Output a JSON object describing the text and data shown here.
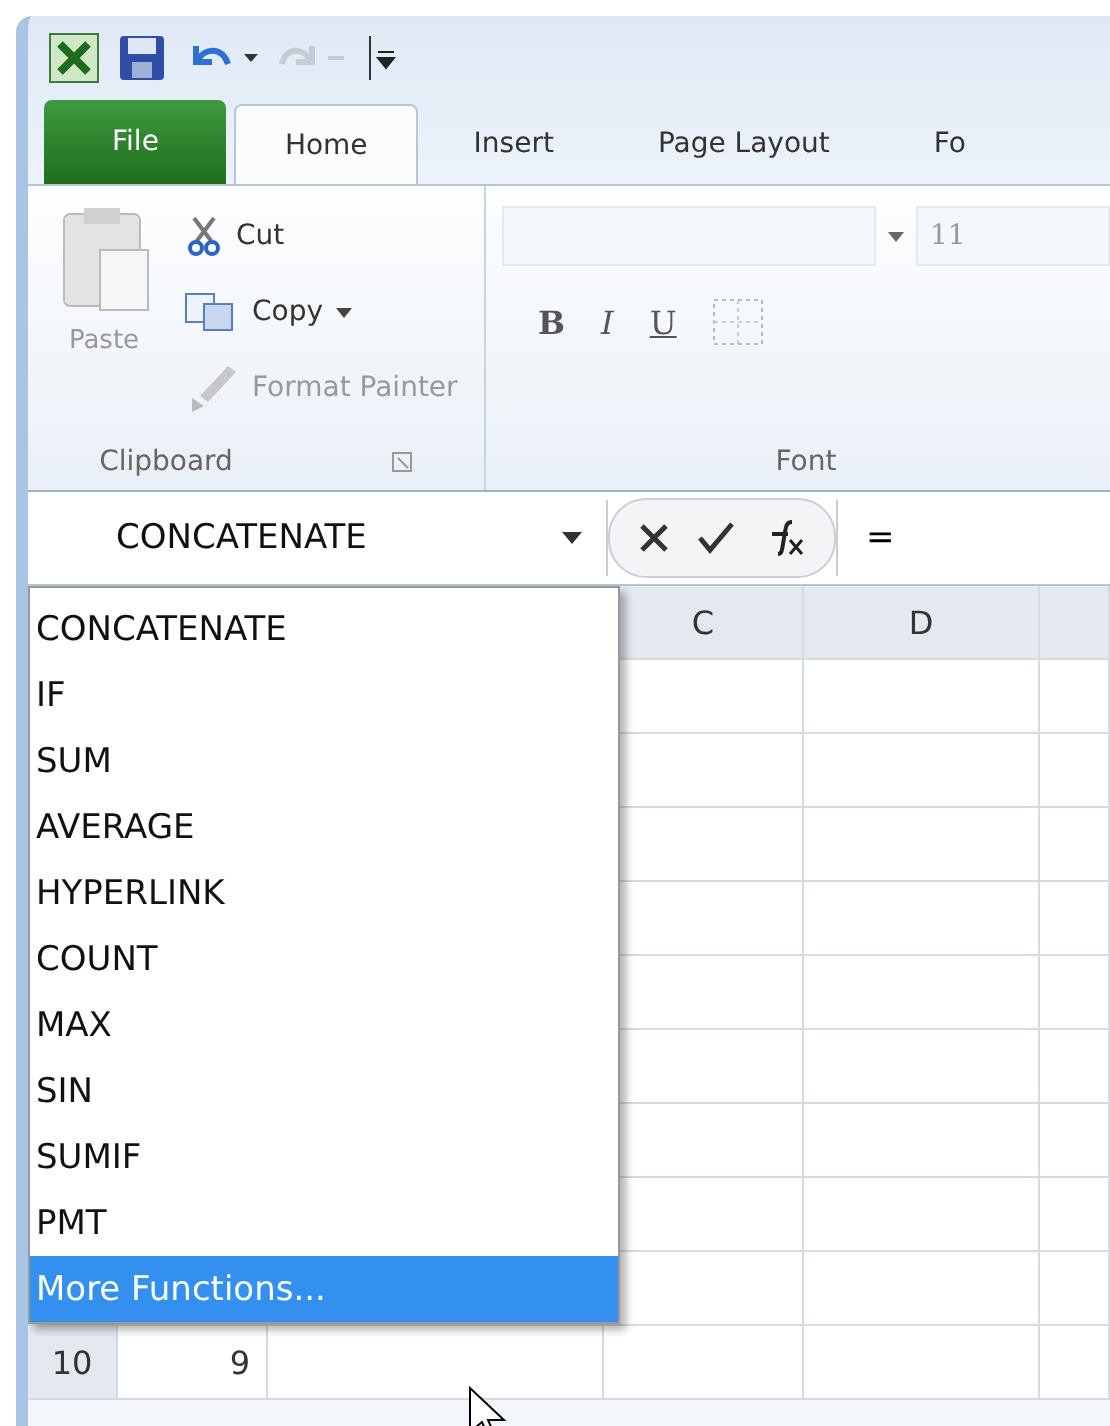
{
  "quick_access": {
    "redo_disabled": true
  },
  "tabs": [
    {
      "label": "File",
      "kind": "file",
      "selected": false
    },
    {
      "label": "Home",
      "kind": "tab",
      "selected": true
    },
    {
      "label": "Insert",
      "kind": "tab",
      "selected": false
    },
    {
      "label": "Page Layout",
      "kind": "tab",
      "selected": false
    },
    {
      "label": "Fo",
      "kind": "tab",
      "selected": false
    }
  ],
  "clipboard": {
    "title": "Clipboard",
    "paste": {
      "label": "Paste",
      "disabled": true
    },
    "cut": {
      "label": "Cut",
      "disabled": false
    },
    "copy": {
      "label": "Copy",
      "disabled": false
    },
    "format_painter": {
      "label": "Format Painter",
      "disabled": true
    }
  },
  "font": {
    "title": "Font",
    "size": "11",
    "bold": "B",
    "italic": "I",
    "underline": "U"
  },
  "formula_bar": {
    "name_box": "CONCATENATE",
    "formula": "="
  },
  "function_list": [
    {
      "label": "CONCATENATE",
      "selected": false
    },
    {
      "label": "IF",
      "selected": false
    },
    {
      "label": "SUM",
      "selected": false
    },
    {
      "label": "AVERAGE",
      "selected": false
    },
    {
      "label": "HYPERLINK",
      "selected": false
    },
    {
      "label": "COUNT",
      "selected": false
    },
    {
      "label": "MAX",
      "selected": false
    },
    {
      "label": "SIN",
      "selected": false
    },
    {
      "label": "SUMIF",
      "selected": false
    },
    {
      "label": "PMT",
      "selected": false
    },
    {
      "label": "More Functions...",
      "selected": true
    }
  ],
  "grid": {
    "visible_columns": [
      "C",
      "D"
    ],
    "rows": [
      {
        "header": "10",
        "cells": [
          "9"
        ]
      }
    ]
  }
}
